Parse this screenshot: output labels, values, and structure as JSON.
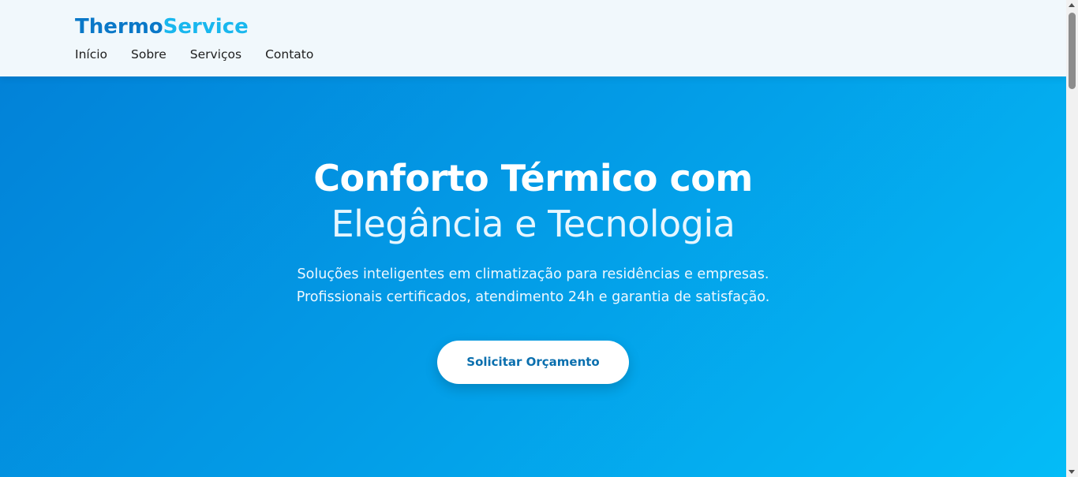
{
  "header": {
    "logo_part1": "Thermo",
    "logo_part2": "Service",
    "nav": [
      {
        "label": "Início"
      },
      {
        "label": "Sobre"
      },
      {
        "label": "Serviços"
      },
      {
        "label": "Contato"
      }
    ]
  },
  "hero": {
    "title_line1": "Conforto Térmico com",
    "title_line2": "Elegância e Tecnologia",
    "subtitle_line1": "Soluções inteligentes em climatização para residências e empresas.",
    "subtitle_line2": "Profissionais certificados, atendimento 24h e garantia de satisfação.",
    "cta_label": "Solicitar Orçamento"
  },
  "colors": {
    "logo_primary": "#0a78c8",
    "logo_accent": "#19b7ee",
    "hero_gradient_start": "#0282d8",
    "hero_gradient_end": "#04bcf7",
    "cta_text": "#0a6fae"
  }
}
